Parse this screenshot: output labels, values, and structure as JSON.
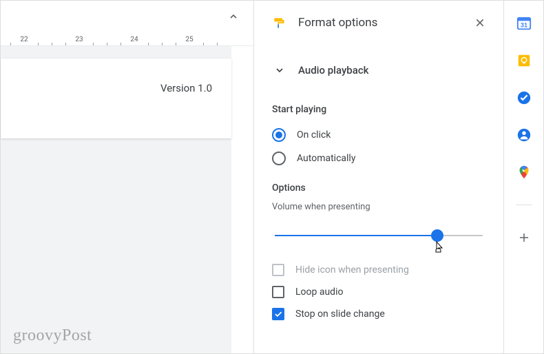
{
  "canvas": {
    "ruler_values": [
      22,
      23,
      24,
      25
    ],
    "slide_text": "Version 1.0"
  },
  "panel": {
    "title": "Format options",
    "section_title": "Audio playback",
    "start_playing_label": "Start playing",
    "radio_on_click": "On click",
    "radio_automatically": "Automatically",
    "options_label": "Options",
    "volume_label": "Volume when presenting",
    "checkbox_hide_icon": "Hide icon when presenting",
    "checkbox_loop_audio": "Loop audio",
    "checkbox_stop_slide": "Stop on slide change"
  },
  "watermark": "groovyPost"
}
